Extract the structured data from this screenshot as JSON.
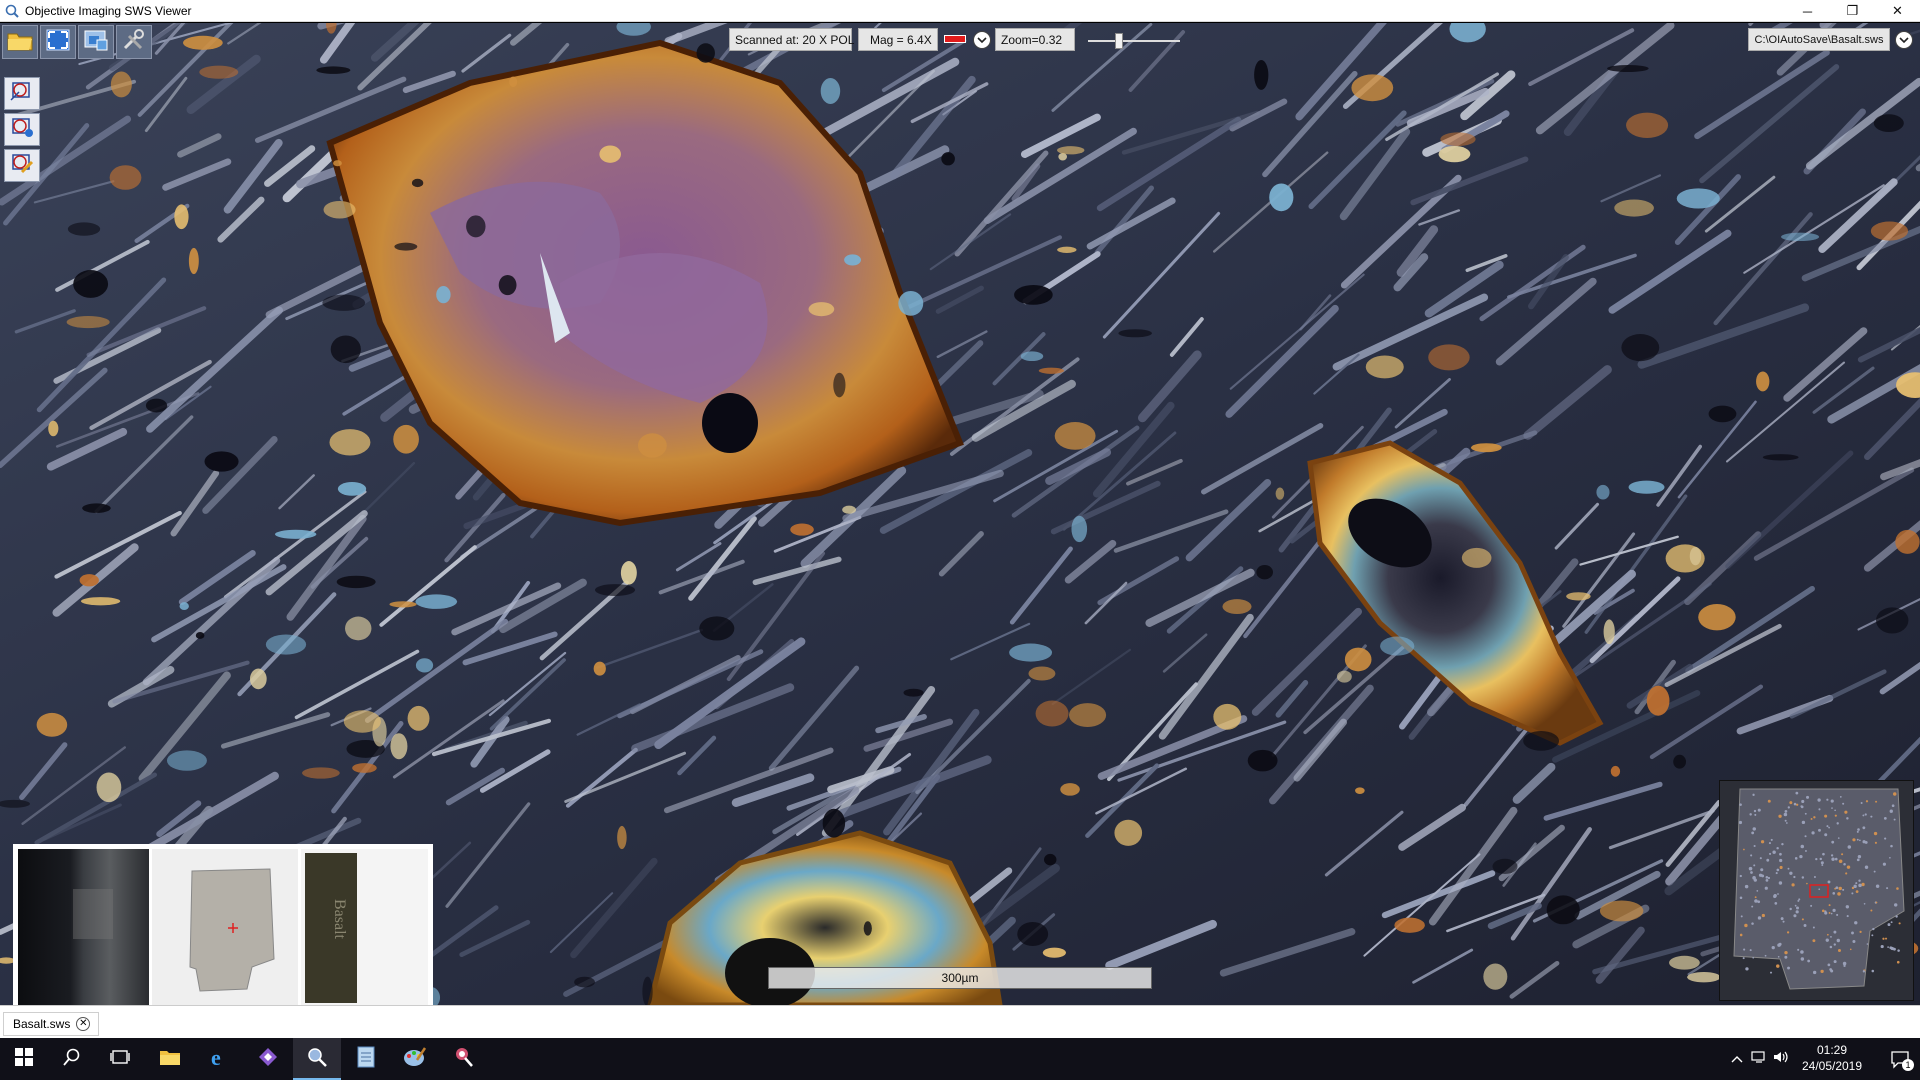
{
  "window": {
    "title": "Objective Imaging SWS Viewer",
    "minimize": "─",
    "restore": "❐",
    "close": "✕"
  },
  "toolbar": {
    "buttons": [
      {
        "icon": "open-folder-icon"
      },
      {
        "icon": "fit-to-window-icon"
      },
      {
        "icon": "screenshot-icon"
      },
      {
        "icon": "tools-icon"
      }
    ]
  },
  "side_tools": {
    "buttons": [
      {
        "icon": "annotation-add-icon"
      },
      {
        "icon": "annotation-info-icon"
      },
      {
        "icon": "annotation-edit-icon"
      }
    ]
  },
  "status": {
    "scanned": "Scanned at: 20 X POL",
    "mag": "Mag = 6.4X",
    "mag_color": "#e21b1b",
    "zoom": "Zoom=0.32",
    "zoom_level": 0.32,
    "path": "C:\\OIAutoSave\\Basalt.sws"
  },
  "thumbnails": {
    "label_text": "Basalt"
  },
  "scalebar": {
    "label": "300µm"
  },
  "tabs": [
    {
      "label": "Basalt.sws"
    }
  ],
  "taskbar": {
    "apps": [
      {
        "icon": "windows-start-icon"
      },
      {
        "icon": "search-icon"
      },
      {
        "icon": "task-view-icon"
      },
      {
        "icon": "file-explorer-icon"
      },
      {
        "icon": "internet-explorer-icon"
      },
      {
        "icon": "visual-studio-icon"
      },
      {
        "icon": "sws-viewer-icon",
        "active": true
      },
      {
        "icon": "notepad-icon"
      },
      {
        "icon": "paint-icon"
      },
      {
        "icon": "microscope-app-icon"
      }
    ],
    "time": "01:29",
    "date": "24/05/2019",
    "notification_count": "1"
  }
}
